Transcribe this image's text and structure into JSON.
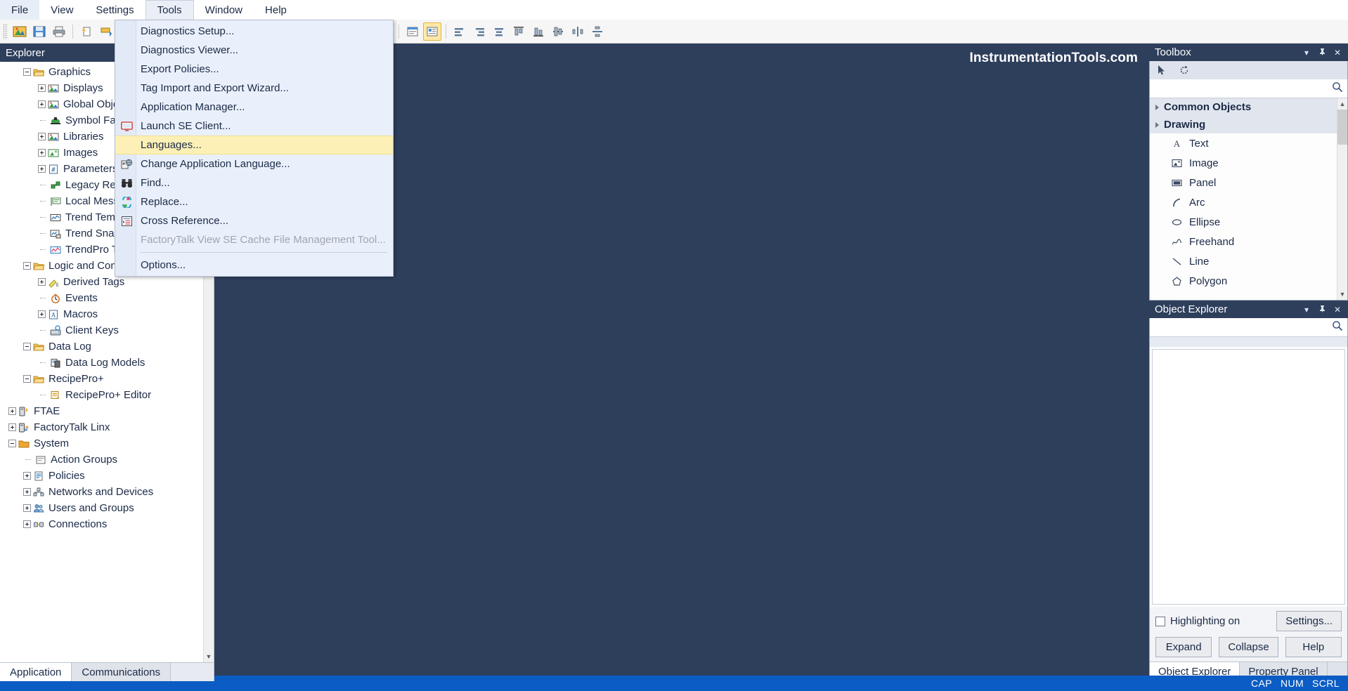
{
  "menubar": {
    "items": [
      {
        "label": "File"
      },
      {
        "label": "View"
      },
      {
        "label": "Settings"
      },
      {
        "label": "Tools"
      },
      {
        "label": "Window"
      },
      {
        "label": "Help"
      }
    ],
    "active": "Tools"
  },
  "tools_menu": {
    "items": [
      {
        "label": "Diagnostics Setup...",
        "icon": "",
        "state": "normal"
      },
      {
        "label": "Diagnostics Viewer...",
        "icon": "",
        "state": "normal"
      },
      {
        "label": "Export Policies...",
        "icon": "",
        "state": "normal"
      },
      {
        "label": "Tag Import and Export Wizard...",
        "icon": "",
        "state": "normal"
      },
      {
        "label": "Application Manager...",
        "icon": "",
        "state": "normal"
      },
      {
        "label": "Launch SE Client...",
        "icon": "monitor-icon",
        "state": "normal"
      },
      {
        "label": "Languages...",
        "icon": "",
        "state": "highlighted"
      },
      {
        "label": "Change Application Language...",
        "icon": "globe-document-icon",
        "state": "normal"
      },
      {
        "label": "Find...",
        "icon": "binoculars-icon",
        "state": "normal"
      },
      {
        "label": "Replace...",
        "icon": "replace-icon",
        "state": "normal"
      },
      {
        "label": "Cross Reference...",
        "icon": "cross-reference-icon",
        "state": "normal"
      },
      {
        "label": "FactoryTalk View SE Cache File Management Tool...",
        "icon": "",
        "state": "disabled"
      },
      {
        "separator": true
      },
      {
        "label": "Options...",
        "icon": "",
        "state": "normal"
      }
    ]
  },
  "explorer": {
    "title": "Explorer",
    "tree": [
      {
        "label": "Graphics",
        "depth": 1,
        "toggle": "minus",
        "icon": "folder-open-icon"
      },
      {
        "label": "Displays",
        "depth": 2,
        "toggle": "plus",
        "icon": "display-icon"
      },
      {
        "label": "Global Objects",
        "depth": 2,
        "toggle": "plus",
        "icon": "global-objects-icon"
      },
      {
        "label": "Symbol Factory",
        "depth": 2,
        "toggle": "none",
        "icon": "symbol-factory-icon"
      },
      {
        "label": "Libraries",
        "depth": 2,
        "toggle": "plus",
        "icon": "libraries-icon"
      },
      {
        "label": "Images",
        "depth": 2,
        "toggle": "plus",
        "icon": "images-icon"
      },
      {
        "label": "Parameters",
        "depth": 2,
        "toggle": "plus",
        "icon": "parameters-icon"
      },
      {
        "label": "Legacy Recipes",
        "depth": 2,
        "toggle": "none",
        "icon": "legacy-recipes-icon"
      },
      {
        "label": "Local Messages",
        "depth": 2,
        "toggle": "none",
        "icon": "local-messages-icon"
      },
      {
        "label": "Trend Templates",
        "depth": 2,
        "toggle": "none",
        "icon": "trend-template-icon"
      },
      {
        "label": "Trend Snapshots",
        "depth": 2,
        "toggle": "none",
        "icon": "trend-snapshot-icon"
      },
      {
        "label": "TrendPro Templates",
        "depth": 2,
        "toggle": "none",
        "icon": "trendpro-icon"
      },
      {
        "label": "Logic and Control",
        "depth": 1,
        "toggle": "minus",
        "icon": "folder-open-icon"
      },
      {
        "label": "Derived Tags",
        "depth": 2,
        "toggle": "plus",
        "icon": "derived-tags-icon"
      },
      {
        "label": "Events",
        "depth": 2,
        "toggle": "none",
        "icon": "events-icon"
      },
      {
        "label": "Macros",
        "depth": 2,
        "toggle": "plus",
        "icon": "macros-icon"
      },
      {
        "label": "Client Keys",
        "depth": 2,
        "toggle": "none",
        "icon": "client-keys-icon"
      },
      {
        "label": "Data Log",
        "depth": 1,
        "toggle": "minus",
        "icon": "folder-open-icon"
      },
      {
        "label": "Data Log Models",
        "depth": 2,
        "toggle": "none",
        "icon": "data-log-models-icon"
      },
      {
        "label": "RecipePro+",
        "depth": 1,
        "toggle": "minus",
        "icon": "folder-open-icon"
      },
      {
        "label": "RecipePro+ Editor",
        "depth": 2,
        "toggle": "none",
        "icon": "recipepro-editor-icon"
      },
      {
        "label": "FTAE",
        "depth": 0,
        "toggle": "plus",
        "icon": "ftae-icon"
      },
      {
        "label": "FactoryTalk Linx",
        "depth": 0,
        "toggle": "plus",
        "icon": "factorytalk-linx-icon"
      },
      {
        "label": "System",
        "depth": 0,
        "toggle": "minus",
        "icon": "folder-closed-icon"
      },
      {
        "label": "Action Groups",
        "depth": 1,
        "toggle": "none",
        "icon": "action-groups-icon"
      },
      {
        "label": "Policies",
        "depth": 1,
        "toggle": "plus",
        "icon": "policies-icon"
      },
      {
        "label": "Networks and Devices",
        "depth": 1,
        "toggle": "plus",
        "icon": "networks-devices-icon"
      },
      {
        "label": "Users and Groups",
        "depth": 1,
        "toggle": "plus",
        "icon": "users-groups-icon"
      },
      {
        "label": "Connections",
        "depth": 1,
        "toggle": "plus",
        "icon": "connections-icon"
      }
    ],
    "tabs": [
      {
        "label": "Application",
        "active": true
      },
      {
        "label": "Communications",
        "active": false
      }
    ]
  },
  "canvas": {
    "watermark": "InstrumentationTools.com"
  },
  "toolbox": {
    "title": "Toolbox",
    "window_buttons": [
      "chevron-down-icon",
      "pin-icon",
      "close-icon"
    ],
    "mini_tools": [
      "select-arrow-icon",
      "rotate-icon"
    ],
    "search_placeholder": "",
    "search_value": "",
    "groups": [
      {
        "label": "Common Objects",
        "expanded": true,
        "items": []
      },
      {
        "label": "Drawing",
        "expanded": true,
        "items": [
          {
            "label": "Text",
            "icon": "text-icon"
          },
          {
            "label": "Image",
            "icon": "image-icon"
          },
          {
            "label": "Panel",
            "icon": "panel-icon"
          },
          {
            "label": "Arc",
            "icon": "arc-icon"
          },
          {
            "label": "Ellipse",
            "icon": "ellipse-icon"
          },
          {
            "label": "Freehand",
            "icon": "freehand-icon"
          },
          {
            "label": "Line",
            "icon": "line-icon"
          },
          {
            "label": "Polygon",
            "icon": "polygon-icon"
          }
        ]
      }
    ]
  },
  "object_explorer": {
    "title": "Object Explorer",
    "window_buttons": [
      "chevron-down-icon",
      "pin-icon",
      "close-icon"
    ],
    "search_placeholder": "",
    "search_value": "",
    "highlighting_label": "Highlighting on",
    "highlighting_checked": false,
    "settings_label": "Settings...",
    "buttons": [
      {
        "label": "Expand"
      },
      {
        "label": "Collapse"
      },
      {
        "label": "Help"
      }
    ],
    "tabs": [
      {
        "label": "Object Explorer",
        "active": true
      },
      {
        "label": "Property Panel",
        "active": false
      }
    ]
  },
  "statusbar": {
    "indicators": [
      "CAP",
      "NUM",
      "SCRL"
    ]
  },
  "colors": {
    "accent_dark": "#2e3f5c",
    "status_bar": "#0b5cc4",
    "menu_highlight": "#fdf0b6",
    "menu_bg": "#eaf0fb"
  }
}
